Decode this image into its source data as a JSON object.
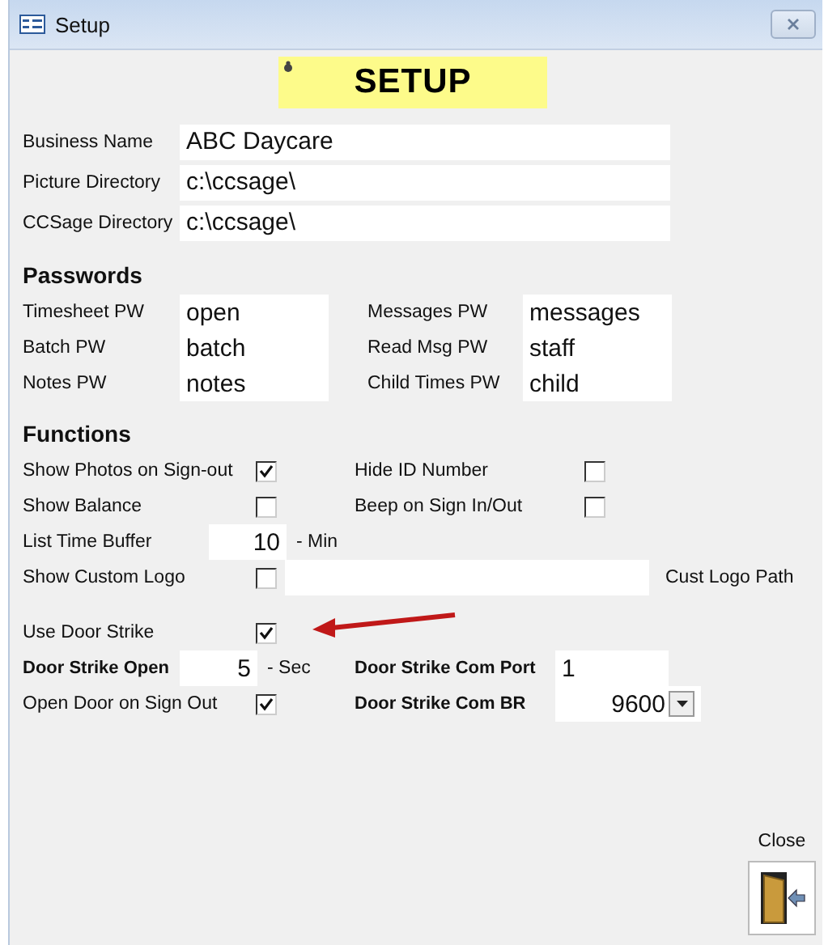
{
  "window": {
    "title": "Setup"
  },
  "banner": {
    "title": "SETUP"
  },
  "general_fields": [
    {
      "label": "Business Name",
      "value": "ABC Daycare"
    },
    {
      "label": "Picture Directory",
      "value": "c:\\ccsage\\"
    },
    {
      "label": "CCSage Directory",
      "value": "c:\\ccsage\\"
    }
  ],
  "passwords": {
    "heading": "Passwords",
    "fields": [
      {
        "label": "Timesheet PW",
        "value": "open"
      },
      {
        "label": "Messages PW",
        "value": "messages"
      },
      {
        "label": "Batch PW",
        "value": "batch"
      },
      {
        "label": "Read Msg PW",
        "value": "staff"
      },
      {
        "label": "Notes PW",
        "value": "notes"
      },
      {
        "label": "Child Times PW",
        "value": "child"
      }
    ]
  },
  "functions": {
    "heading": "Functions",
    "rows": [
      [
        {
          "kind": "checkbox",
          "label": "Show Photos on Sign-out",
          "checked": true
        },
        {
          "kind": "checkbox",
          "label": "Hide ID Number",
          "checked": false
        }
      ],
      [
        {
          "kind": "checkbox",
          "label": "Show Balance",
          "checked": false
        },
        {
          "kind": "checkbox",
          "label": "Beep on Sign In/Out",
          "checked": false
        }
      ],
      [
        {
          "kind": "number",
          "label": "List Time Buffer",
          "value": "10",
          "unit": "- Min"
        }
      ],
      [
        {
          "kind": "logo",
          "label": "Show Custom Logo",
          "checked": false,
          "caption": "Cust Logo Path"
        }
      ]
    ]
  },
  "door": {
    "rows": [
      [
        {
          "kind": "checkbox",
          "label": "Use Door Strike",
          "checked": true
        }
      ],
      [
        {
          "kind": "number",
          "label": "Door Strike Open",
          "value": "5",
          "unit": "- Sec"
        },
        {
          "kind": "field",
          "label": "Door Strike Com Port",
          "value": "1"
        }
      ],
      [
        {
          "kind": "checkbox",
          "label": "Open Door on Sign Out",
          "checked": true
        },
        {
          "kind": "dropdown",
          "label": "Door Strike Com BR",
          "value": "9600"
        }
      ]
    ]
  },
  "close_button": {
    "label": "Close"
  }
}
